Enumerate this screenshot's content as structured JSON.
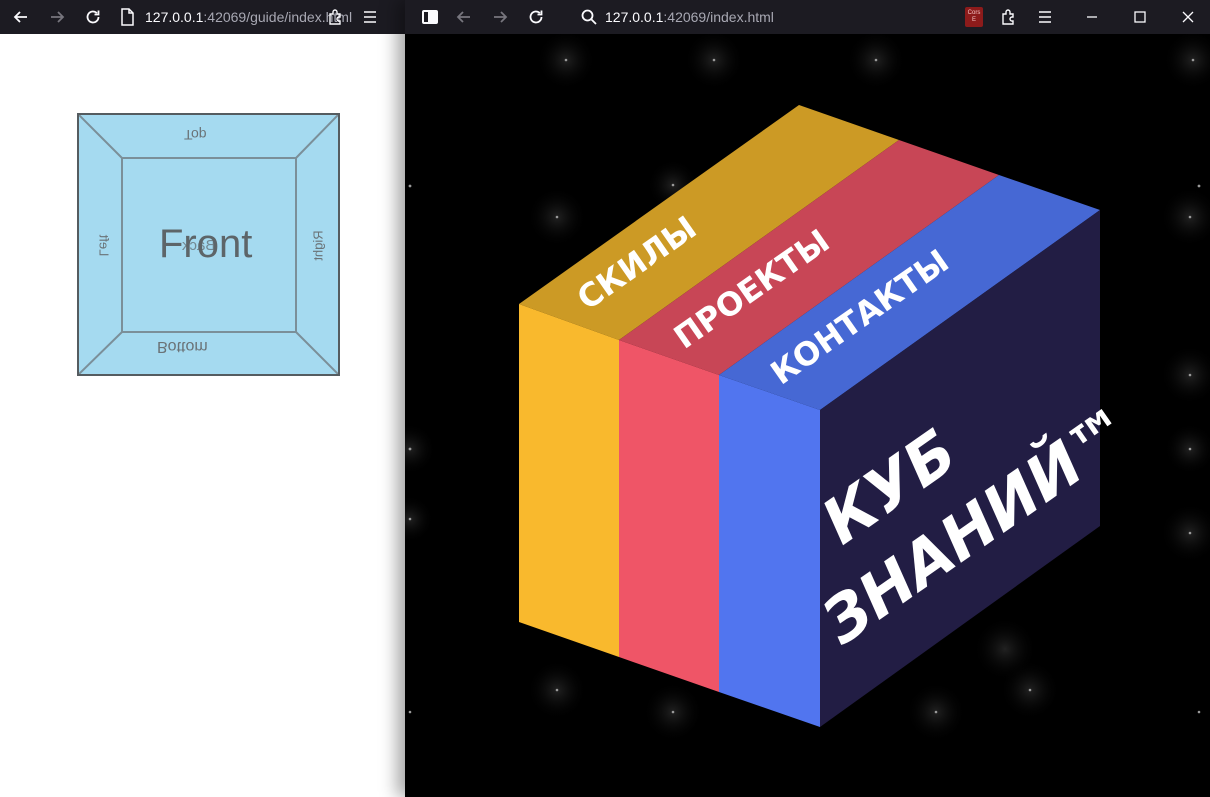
{
  "left_window": {
    "url_host": "127.0.0.1",
    "url_rest": ":42069/guide/index.html",
    "guide": {
      "front": "Front",
      "back": "Back",
      "top": "Top",
      "bottom": "Bottom",
      "left": "Left",
      "right": "Right"
    }
  },
  "right_window": {
    "url_host": "127.0.0.1",
    "url_rest": ":42069/index.html",
    "extension_badge": "Cors E",
    "cube": {
      "tab_skills": "СКИЛЫ",
      "tab_projects": "ПРОЕКТЫ",
      "tab_contacts": "КОНТАКТЫ",
      "title_line1": "КУБ",
      "title_line2": "ЗНАНИЙ™",
      "colors": {
        "skills_top": "#cc9a25",
        "skills_front": "#f9b92d",
        "projects_top": "#c84656",
        "projects_front": "#ef5567",
        "contacts_top": "#4668d4",
        "contacts_front": "#5175ef",
        "right_face": "#221d44"
      }
    }
  }
}
